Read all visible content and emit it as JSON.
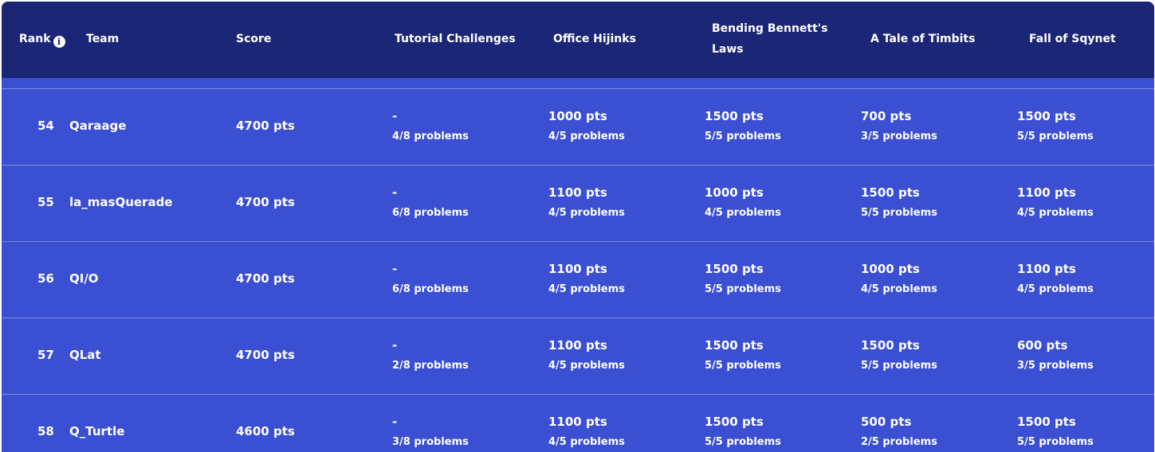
{
  "header": {
    "rank": "Rank",
    "team": "Team",
    "score": "Score",
    "tutorial": "Tutorial Challenges",
    "office": "Office Hijinks",
    "bending_line1": "Bending Bennett's",
    "bending_line2": "Laws",
    "timbits": "A Tale of Timbits",
    "sqynet": "Fall of Sqynet",
    "info_icon": "i"
  },
  "rows": [
    {
      "rank": "54",
      "team": "Qaraage",
      "score": "4700 pts",
      "challenges": [
        {
          "pts": "-",
          "problems": "4/8 problems"
        },
        {
          "pts": "1000 pts",
          "problems": "4/5 problems"
        },
        {
          "pts": "1500 pts",
          "problems": "5/5 problems"
        },
        {
          "pts": "700 pts",
          "problems": "3/5 problems"
        },
        {
          "pts": "1500 pts",
          "problems": "5/5 problems"
        }
      ]
    },
    {
      "rank": "55",
      "team": "la_masQuerade",
      "score": "4700 pts",
      "challenges": [
        {
          "pts": "-",
          "problems": "6/8 problems"
        },
        {
          "pts": "1100 pts",
          "problems": "4/5 problems"
        },
        {
          "pts": "1000 pts",
          "problems": "4/5 problems"
        },
        {
          "pts": "1500 pts",
          "problems": "5/5 problems"
        },
        {
          "pts": "1100 pts",
          "problems": "4/5 problems"
        }
      ]
    },
    {
      "rank": "56",
      "team": "QI/O",
      "score": "4700 pts",
      "challenges": [
        {
          "pts": "-",
          "problems": "6/8 problems"
        },
        {
          "pts": "1100 pts",
          "problems": "4/5 problems"
        },
        {
          "pts": "1500 pts",
          "problems": "5/5 problems"
        },
        {
          "pts": "1000 pts",
          "problems": "4/5 problems"
        },
        {
          "pts": "1100 pts",
          "problems": "4/5 problems"
        }
      ]
    },
    {
      "rank": "57",
      "team": "QLat",
      "score": "4700 pts",
      "challenges": [
        {
          "pts": "-",
          "problems": "2/8 problems"
        },
        {
          "pts": "1100 pts",
          "problems": "4/5 problems"
        },
        {
          "pts": "1500 pts",
          "problems": "5/5 problems"
        },
        {
          "pts": "1500 pts",
          "problems": "5/5 problems"
        },
        {
          "pts": "600 pts",
          "problems": "3/5 problems"
        }
      ]
    },
    {
      "rank": "58",
      "team": "Q_Turtle",
      "score": "4600 pts",
      "challenges": [
        {
          "pts": "-",
          "problems": "3/8 problems"
        },
        {
          "pts": "1100 pts",
          "problems": "4/5 problems"
        },
        {
          "pts": "1500 pts",
          "problems": "5/5 problems"
        },
        {
          "pts": "500 pts",
          "problems": "2/5 problems"
        },
        {
          "pts": "1500 pts",
          "problems": "5/5 problems"
        }
      ]
    }
  ]
}
